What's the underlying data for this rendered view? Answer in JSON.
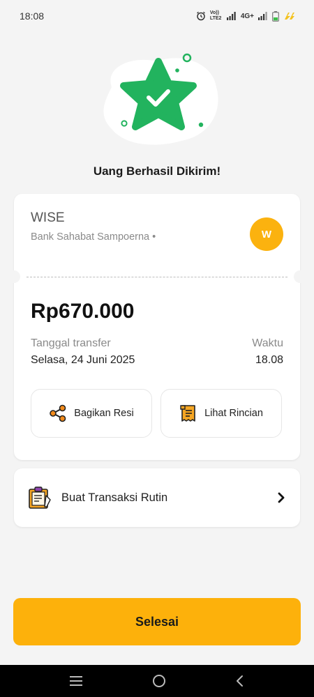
{
  "status_bar": {
    "time": "18:08",
    "network_label": "Vo)) LTE2",
    "signal_label": "4G+"
  },
  "success": {
    "title": "Uang Berhasil Dikirim!"
  },
  "recipient": {
    "name": "WISE",
    "bank": "Bank Sahabat Sampoerna •",
    "avatar_letter": "W",
    "avatar_color": "#fbb20f"
  },
  "transfer": {
    "amount": "Rp670.000",
    "date_label": "Tanggal transfer",
    "date_value": "Selasa, 24 Juni 2025",
    "time_label": "Waktu",
    "time_value": "18.08"
  },
  "actions": {
    "share_label": "Bagikan Resi",
    "detail_label": "Lihat Rincian"
  },
  "routine": {
    "label": "Buat Transaksi Rutin"
  },
  "done_button": {
    "label": "Selesai",
    "color": "#fdb10b"
  },
  "theme": {
    "success_green": "#22b35e",
    "accent_orange": "#f28b1c",
    "background": "#f4f4f4"
  }
}
